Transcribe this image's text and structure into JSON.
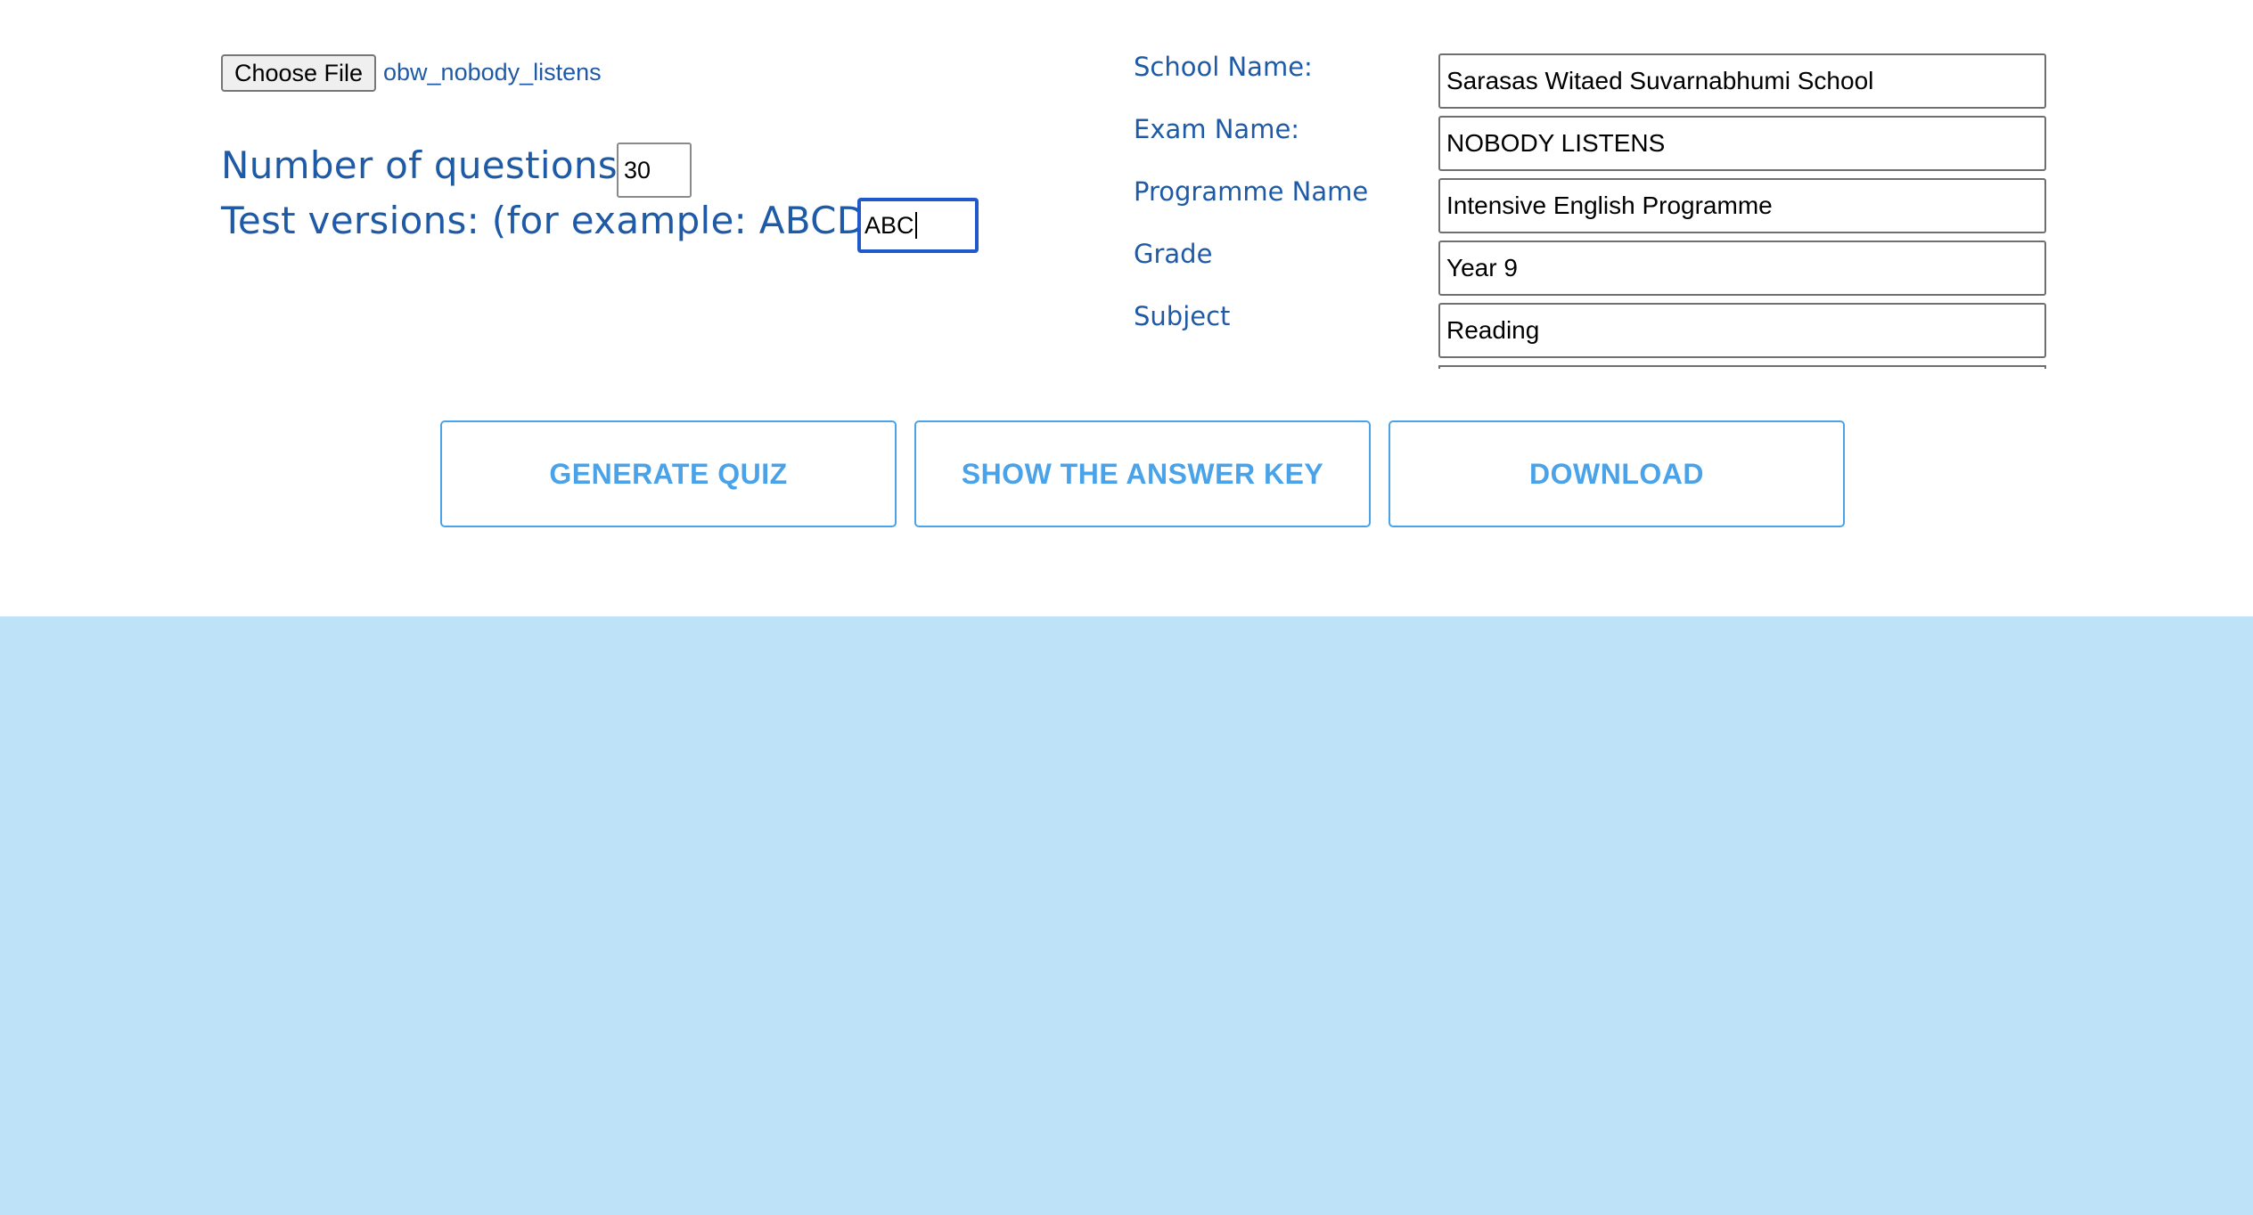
{
  "file_input": {
    "button_label": "Choose File",
    "file_name": "obw_nobody_listens"
  },
  "quiz_settings": {
    "questions_label": "Number of questions:",
    "questions_value": "30",
    "versions_label": "Test versions: (for example: ABCDE)",
    "versions_value": "ABC"
  },
  "exam_info": {
    "fields": [
      {
        "label": "School Name:",
        "value": "Sarasas Witaed Suvarnabhumi School"
      },
      {
        "label": "Exam Name:",
        "value": "NOBODY LISTENS"
      },
      {
        "label": "Programme Name",
        "value": "Intensive English Programme"
      },
      {
        "label": "Grade",
        "value": "Year 9"
      },
      {
        "label": "Subject",
        "value": "Reading"
      }
    ]
  },
  "actions": {
    "generate_label": "GENERATE QUIZ",
    "answer_key_label": "SHOW THE ANSWER KEY",
    "download_label": "DOWNLOAD"
  },
  "colors": {
    "label_text": "#1f5aa6",
    "button_accent": "#4aa3e8",
    "focus_border": "#2059c9",
    "bottom_background": "#bee3f8"
  }
}
